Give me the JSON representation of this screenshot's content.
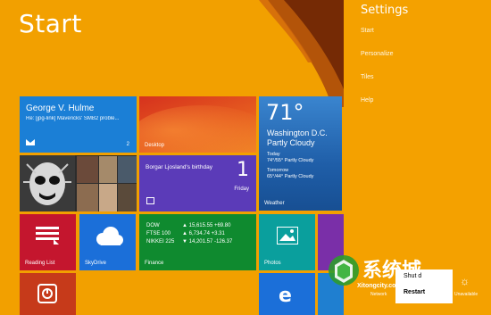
{
  "start": {
    "title": "Start"
  },
  "tiles": {
    "mail": {
      "name": "George V. Hulme",
      "subject": "Re: [jpg-link] Mavericks' SMB2 proble...",
      "count": "2"
    },
    "desktop": {
      "label": "Desktop"
    },
    "weather": {
      "temp": "71°",
      "city": "Washington D.C.",
      "condition": "Partly Cloudy",
      "today": "Today",
      "today_range": "74°/55° Partly Cloudy",
      "tomorrow": "Tomorrow",
      "tomorrow_range": "65°/44° Partly Cloudy",
      "label": "Weather"
    },
    "birthday": {
      "text": "Borgar Ljosland's birthday",
      "day_num": "1",
      "day_name": "Friday"
    },
    "reading": {
      "label": "Reading List"
    },
    "skydrive": {
      "label": "SkyDrive"
    },
    "finance": {
      "label": "Finance",
      "rows": [
        {
          "name": "DOW",
          "value": "▲ 15,615.55 +69.80"
        },
        {
          "name": "FTSE 100",
          "value": "▲ 6,734.74 +3.31"
        },
        {
          "name": "NIKKEI 225",
          "value": "▼ 14,201.57 -126.37"
        }
      ]
    },
    "photos": {
      "label": "Photos"
    }
  },
  "settings": {
    "title": "Settings",
    "items": [
      "Start",
      "Personalize",
      "Tiles",
      "Help"
    ],
    "network_label": "Network",
    "unavailable_label": "Unavailable",
    "power_menu": {
      "shutdown": "Shut d",
      "restart": "Restart"
    }
  },
  "watermark": {
    "text": "系统城",
    "url": "Xitongcity.com"
  },
  "colors": {
    "background": "#f2a000",
    "mail": "#1b7fd6",
    "birthday": "#5b3bb8",
    "finance": "#0f8a2f",
    "photos": "#0a9f9d"
  }
}
